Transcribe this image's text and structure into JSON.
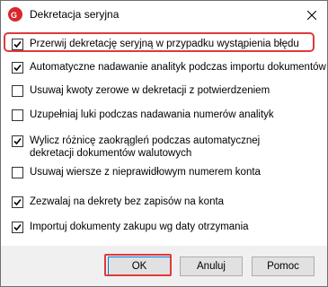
{
  "window": {
    "title": "Dekretacja seryjna"
  },
  "options": [
    {
      "label": "Przerwij dekretację seryjną w przypadku wystąpienia błędu",
      "checked": true
    },
    {
      "label": "Automatyczne nadawanie analityk podczas importu dokumentów",
      "checked": true
    },
    {
      "label": "Usuwaj kwoty zerowe w dekretacji z potwierdzeniem",
      "checked": false
    },
    {
      "label": "Uzupełniaj luki podczas nadawania numerów analityk",
      "checked": false
    },
    {
      "label": "Wylicz różnicę zaokrągleń podczas automatycznej dekretacji dokumentów walutowych",
      "checked": true
    },
    {
      "label": "Usuwaj wiersze z nieprawidłowym numerem konta",
      "checked": false
    },
    {
      "label": "Zezwalaj na dekrety bez zapisów na konta",
      "checked": true
    },
    {
      "label": "Importuj dokumenty zakupu wg daty otrzymania",
      "checked": true
    }
  ],
  "buttons": {
    "ok": "OK",
    "cancel": "Anuluj",
    "help": "Pomoc"
  }
}
